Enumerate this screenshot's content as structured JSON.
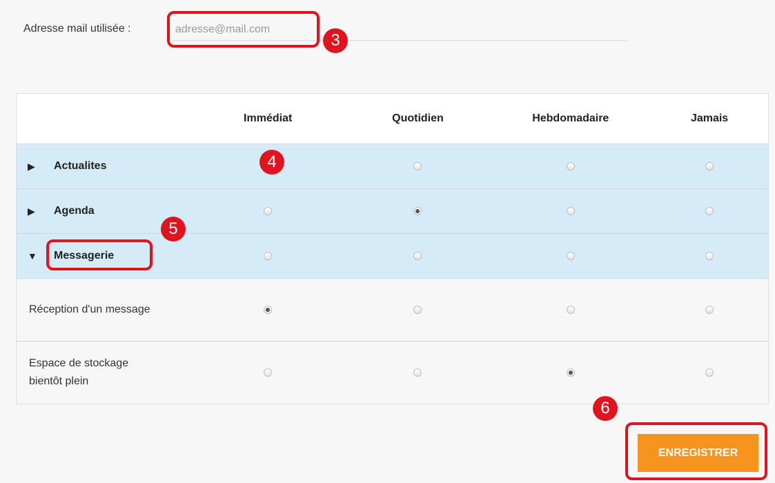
{
  "email": {
    "label": "Adresse mail utilisée :",
    "placeholder": "adresse@mail.com"
  },
  "table": {
    "columns": [
      "Immédiat",
      "Quotidien",
      "Hebdomadaire",
      "Jamais"
    ],
    "rows": [
      {
        "type": "category",
        "label": "Actualites",
        "expanded": false,
        "selected": 0
      },
      {
        "type": "category",
        "label": "Agenda",
        "expanded": false,
        "selected": 1
      },
      {
        "type": "category",
        "label": "Messagerie",
        "expanded": true,
        "selected": null
      },
      {
        "type": "item",
        "label": "Réception d'un message",
        "selected": 0
      },
      {
        "type": "item",
        "label": "Espace de stockage bientôt plein",
        "selected": 2
      }
    ]
  },
  "save_button": {
    "label": "ENREGISTRER"
  },
  "annotations": [
    "3",
    "4",
    "5",
    "6"
  ],
  "colors": {
    "accent": "#f7941d",
    "category_bg": "#d5ecf8",
    "annotation_red": "#e0141e"
  },
  "icons": {
    "collapsed": "triangle-right-icon",
    "expanded": "triangle-down-icon"
  }
}
